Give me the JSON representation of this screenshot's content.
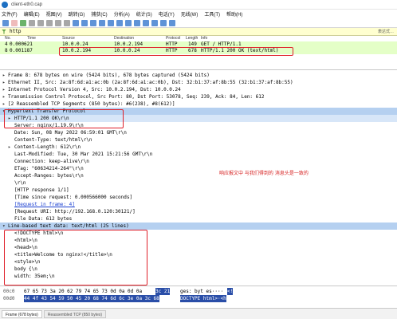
{
  "window": {
    "title": "client-eth0.cap"
  },
  "menu": [
    "文件(F)",
    "编辑(E)",
    "视图(V)",
    "跳转(G)",
    "捕获(C)",
    "分析(A)",
    "统计(S)",
    "电话(Y)",
    "无线(W)",
    "工具(T)",
    "帮助(H)"
  ],
  "toolbar": {
    "buttons": [
      "shark-fin-icon",
      "stop-icon",
      "restart-icon",
      "options-icon",
      "open-icon",
      "save-icon",
      "close-file-icon",
      "reload-icon",
      "find-icon",
      "back-icon",
      "forward-icon",
      "go-to-packet-icon",
      "first-packet-icon",
      "last-packet-icon",
      "autoscroll-icon",
      "colorize-icon",
      "zoom-in-icon",
      "zoom-out-icon",
      "zoom-reset-icon",
      "resize-columns-icon"
    ],
    "colors": {
      "blue": "#2a6fc9",
      "red": "#d23b3b",
      "green": "#3a9a3a",
      "grey": "#8a8a8a"
    }
  },
  "filter": {
    "value": "http",
    "right_label": "表达式…"
  },
  "columns": {
    "no": "No.",
    "time": "Time",
    "source": "Source",
    "destination": "Destination",
    "protocol": "Protocol",
    "length": "Length",
    "info": "Info"
  },
  "packets": [
    {
      "no": "4",
      "time": "0.000621",
      "source": "10.0.0.24",
      "destination": "10.0.2.194",
      "protocol": "HTTP",
      "length": "149",
      "info": "GET / HTTP/1.1"
    },
    {
      "no": "8",
      "time": "0.001187",
      "source": "10.0.2.194",
      "destination": "10.0.0.24",
      "protocol": "HTTP",
      "length": "678",
      "info": "HTTP/1.1 200 OK  (text/html)"
    }
  ],
  "details": [
    "Frame 8: 678 bytes on wire (5424 bits), 678 bytes captured (5424 bits)",
    "Ethernet II, Src: 2a:8f:6d:a1:ac:0b (2a:8f:6d:a1:ac:0b), Dst: 32:b1:37:af:8b:55 (32:b1:37:af:8b:55)",
    "Internet Protocol Version 4, Src: 10.0.2.194, Dst: 10.0.0.24",
    "Transmission Control Protocol, Src Port: 80, Dst Port: 53078, Seq: 239, Ack: 84, Len: 612",
    "[2 Reassembled TCP Segments (850 bytes): #6(238), #8(612)]",
    "Hypertext Transfer Protocol",
    "HTTP/1.1 200 OK\\r\\n",
    "Server: nginx/1.19.9\\r\\n",
    "Date: Sun, 08 May 2022 06:59:01 GMT\\r\\n",
    "Content-Type: text/html\\r\\n",
    "Content-Length: 612\\r\\n",
    "Last-Modified: Tue, 30 Mar 2021 15:21:56 GMT\\r\\n",
    "Connection: keep-alive\\r\\n",
    "ETag: \"60634214-264\"\\r\\n",
    "Accept-Ranges: bytes\\r\\n",
    "\\r\\n",
    "[HTTP response 1/1]",
    "[Time since request: 0.000566000 seconds]",
    "[Request in frame: 4]",
    "[Request URI: http://192.168.0.120:30121/]",
    "File Data: 612 bytes",
    "Line-based text data: text/html (25 lines)",
    "<!DOCTYPE html>\\n",
    "<html>\\n",
    "<head>\\n",
    "<title>Welcome to nginx!</title>\\n",
    "<style>\\n",
    "    body {\\n",
    "        width: 35em;\\n"
  ],
  "annotation": "响应报文中 与我们得到的 消息头是一致的",
  "hex": [
    {
      "offset": "00c0",
      "bytes": "67 65 73 3a 20 62 79 74  65 73 0d 0a 0d 0a",
      "bytes_sel": "3c 21",
      "ascii": "ges: byt es····",
      "ascii_sel": "<!"
    },
    {
      "offset": "00d0",
      "bytes": "",
      "bytes_sel": "44 4f 43 54 59 50 45 20  68 74 6d 6c 3e 0a 3c 68",
      "ascii": "",
      "ascii_sel": "DOCTYPE  html>·<h"
    }
  ],
  "status": {
    "tab1": "Frame (678 bytes)",
    "tab2": "Reassembled TCP (850 bytes)"
  }
}
